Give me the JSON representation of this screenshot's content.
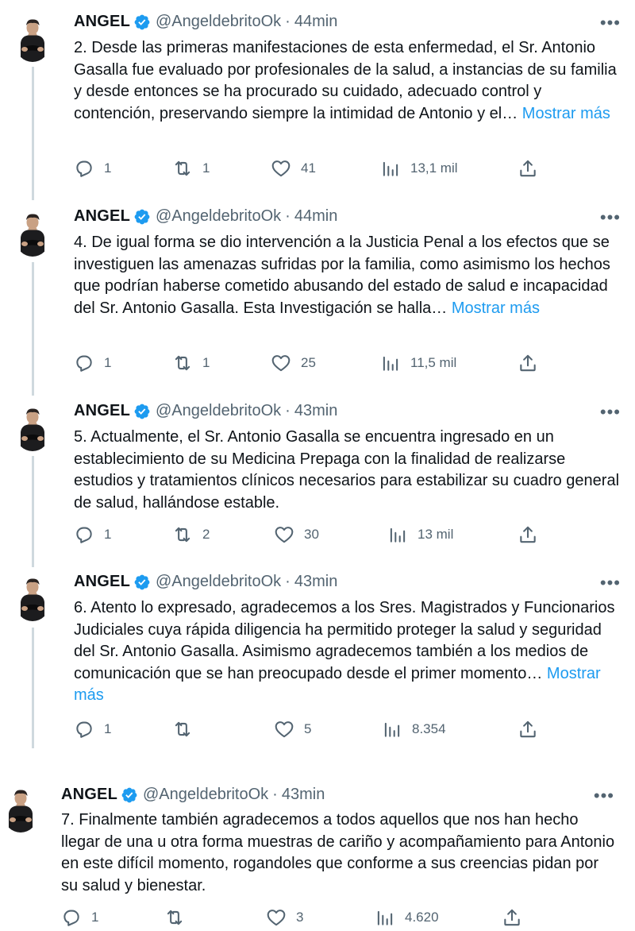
{
  "tweets": [
    {
      "name": "ANGEL",
      "handle": "@AngeldebritoOk",
      "separator": "·",
      "time": "44min",
      "text": "2. Desde las primeras manifestaciones de esta enfermedad, el Sr. Antonio Gasalla fue evaluado por profesionales de la salud, a instancias de su familia y desde entonces se ha procurado su cuidado, adecuado control y contención, preservando siempre la intimidad de Antonio y el…",
      "show_more": "Mostrar más",
      "replies": "1",
      "retweets": "1",
      "likes": "41",
      "views": "13,1 mil"
    },
    {
      "name": "ANGEL",
      "handle": "@AngeldebritoOk",
      "separator": "·",
      "time": "44min",
      "text": "4. De igual forma se dio intervención a la Justicia Penal a los efectos que se investiguen las amenazas sufridas por la familia, como asimismo los hechos que podrían haberse cometido abusando del estado de salud e incapacidad del Sr. Antonio Gasalla. Esta Investigación se halla…",
      "show_more": "Mostrar más",
      "replies": "1",
      "retweets": "1",
      "likes": "25",
      "views": "11,5 mil"
    },
    {
      "name": "ANGEL",
      "handle": "@AngeldebritoOk",
      "separator": "·",
      "time": "43min",
      "text": "5. Actualmente, el Sr. Antonio Gasalla se encuentra ingresado en un establecimiento de su Medicina Prepaga con la finalidad de realizarse estudios y tratamientos clínicos necesarios para estabilizar su cuadro general de salud, hallándose estable.",
      "show_more": "",
      "replies": "1",
      "retweets": "2",
      "likes": "30",
      "views": "13 mil"
    },
    {
      "name": "ANGEL",
      "handle": "@AngeldebritoOk",
      "separator": "·",
      "time": "43min",
      "text": "6. Atento lo expresado, agradecemos a los Sres. Magistrados y Funcionarios Judiciales cuya rápida diligencia ha permitido proteger la salud y seguridad del Sr. Antonio Gasalla. Asimismo agradecemos también a los medios de comunicación que se han preocupado desde el primer momento…",
      "show_more": "Mostrar más",
      "replies": "1",
      "retweets": "",
      "likes": "5",
      "views": "8.354"
    },
    {
      "name": "ANGEL",
      "handle": "@AngeldebritoOk",
      "separator": "·",
      "time": "43min",
      "text": "7. Finalmente también agradecemos a todos aquellos que nos han hecho llegar de una u otra forma muestras de cariño y acompañamiento para Antonio en este difícil momento, rogandoles que conforme a sus creencias pidan por su salud y bienestar.",
      "show_more": "",
      "replies": "1",
      "retweets": "",
      "likes": "3",
      "views": "4.620"
    }
  ],
  "more_menu_glyph": "•••",
  "colors": {
    "link": "#1d9bf0",
    "muted": "#536471",
    "verified": "#1d9bf0",
    "thread_line": "#cfd9de"
  }
}
